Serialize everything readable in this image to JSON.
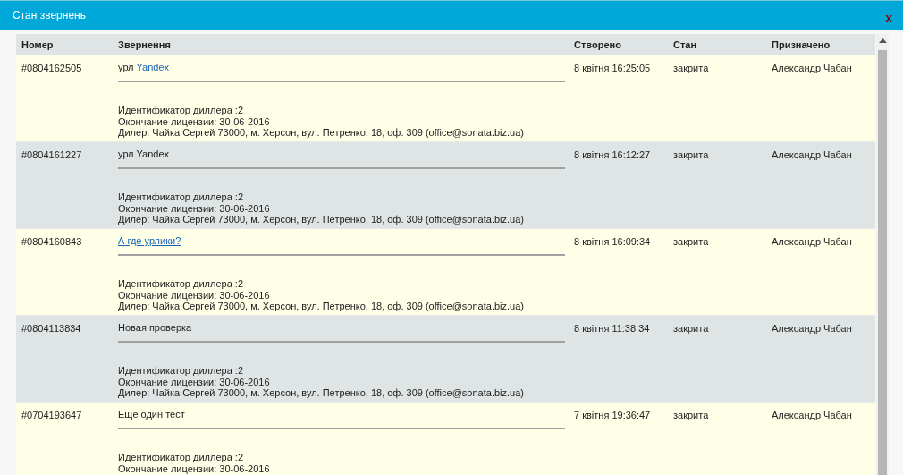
{
  "window": {
    "title": "Стан звернень",
    "close": "x"
  },
  "table": {
    "columns": [
      "Номер",
      "Звернення",
      "Створено",
      "Стан",
      "Призначено"
    ],
    "rows": [
      {
        "number": "#0804162505",
        "subject": [
          {
            "kind": "text",
            "text": "урл "
          },
          {
            "kind": "link",
            "text": "Yandex"
          }
        ],
        "details": [
          "Идентификатор диллера :2",
          "Окончание лицензии: 30-06-2016",
          "Дилер: Чайка Сергей 73000, м. Херсон, вул. Петренко, 18, оф. 309 (office@sonata.biz.ua)"
        ],
        "created": "8 квітня 16:25:05",
        "status": "закрита",
        "assignee": "Александр Чабан"
      },
      {
        "number": "#0804161227",
        "subject": [
          {
            "kind": "text",
            "text": "урл Yandex"
          }
        ],
        "details": [
          "Идентификатор диллера :2",
          "Окончание лицензии: 30-06-2016",
          "Дилер: Чайка Сергей 73000, м. Херсон, вул. Петренко, 18, оф. 309 (office@sonata.biz.ua)"
        ],
        "created": "8 квітня 16:12:27",
        "status": "закрита",
        "assignee": "Александр Чабан"
      },
      {
        "number": "#0804160843",
        "subject": [
          {
            "kind": "link",
            "text": "А где урлики?"
          }
        ],
        "details": [
          "Идентификатор диллера :2",
          "Окончание лицензии: 30-06-2016",
          "Дилер: Чайка Сергей 73000, м. Херсон, вул. Петренко, 18, оф. 309 (office@sonata.biz.ua)"
        ],
        "created": "8 квітня 16:09:34",
        "status": "закрита",
        "assignee": "Александр Чабан"
      },
      {
        "number": "#0804113834",
        "subject": [
          {
            "kind": "text",
            "text": "Новая проверка"
          }
        ],
        "details": [
          "Идентификатор диллера :2",
          "Окончание лицензии: 30-06-2016",
          "Дилер: Чайка Сергей 73000, м. Херсон, вул. Петренко, 18, оф. 309 (office@sonata.biz.ua)"
        ],
        "created": "8 квітня 11:38:34",
        "status": "закрита",
        "assignee": "Александр Чабан"
      },
      {
        "number": "#0704193647",
        "subject": [
          {
            "kind": "text",
            "text": "Ещё один тест"
          }
        ],
        "details": [
          "Идентификатор диллера :2",
          "Окончание лицензии: 30-06-2016"
        ],
        "created": "7 квітня 19:36:47",
        "status": "закрита",
        "assignee": "Александр Чабан"
      }
    ]
  }
}
